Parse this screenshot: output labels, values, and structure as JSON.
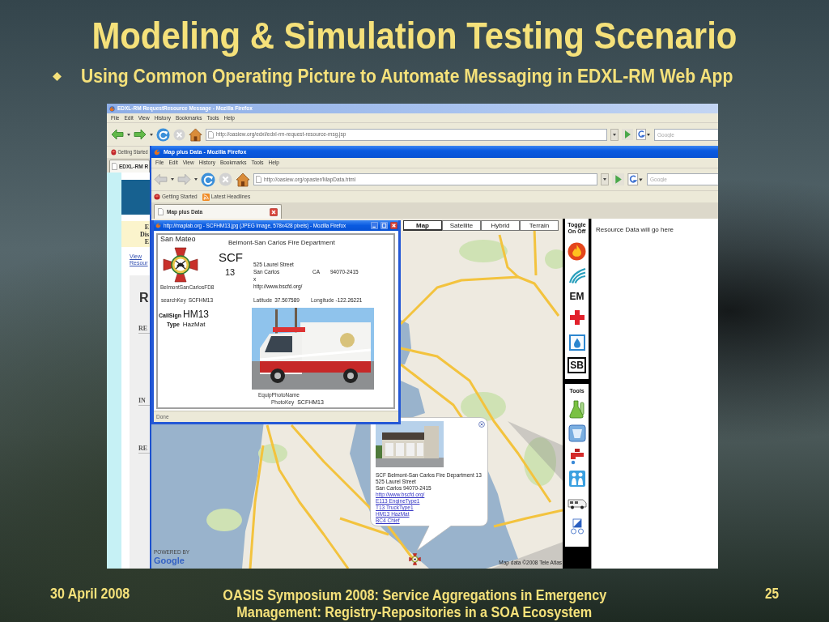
{
  "slide": {
    "title": "Modeling & Simulation Testing Scenario",
    "bullets": [
      "Using Common Operating Picture to Automate Messaging in EDXL-RM Web App"
    ]
  },
  "back_window": {
    "title": "EDXL-RM RequestResource Message - Mozilla Firefox",
    "menu": [
      "File",
      "Edit",
      "View",
      "History",
      "Bookmarks",
      "Tools",
      "Help"
    ],
    "navigation": {
      "back_disabled": false,
      "forward_disabled": false,
      "stop_disabled": true
    },
    "address": "http://oasiew.org/edxl/edxl-rm-request-resource-msg.jsp",
    "search": {
      "placeholder": "Google"
    },
    "bookmarks": [
      {
        "label": "Getting Started",
        "kind": "page"
      }
    ],
    "tabs": [
      {
        "label": "EDXL-RM R",
        "selected": true
      }
    ],
    "page": {
      "banner_lines": [
        "E",
        "Dis",
        "E"
      ],
      "links": [
        "View",
        "Resour"
      ],
      "heading": "R",
      "labels": [
        "RE",
        "IN",
        "RE"
      ]
    }
  },
  "map_window": {
    "title": "Map plus Data - Mozilla Firefox",
    "menu": [
      "File",
      "Edit",
      "View",
      "History",
      "Bookmarks",
      "Tools",
      "Help"
    ],
    "navigation": {
      "back_disabled": true,
      "forward_disabled": true,
      "stop_disabled": true
    },
    "address": "http://oasiew.org/opaster/MapData.html",
    "search": {
      "placeholder": "Google"
    },
    "bookmarks": [
      {
        "label": "Getting Started",
        "kind": "page"
      },
      {
        "label": "Latest Headlines",
        "kind": "feed"
      }
    ],
    "tabs": [
      {
        "label": "Map plus Data",
        "selected": true
      }
    ],
    "map": {
      "types": [
        {
          "label": "Map",
          "selected": true
        },
        {
          "label": "Satellite",
          "selected": false
        },
        {
          "label": "Hybrid",
          "selected": false
        },
        {
          "label": "Terrain",
          "selected": false
        }
      ],
      "info_bubble": {
        "lines": [
          "SCF Belmont-San Carlos Fire Department 13",
          "525 Laurel Street",
          "San Carlos 94070-2415"
        ],
        "links": [
          "http://www.bscfd.org/",
          "E113 EngineType1",
          "T13 TruckType1",
          "HM13 HazMat",
          "BC4 Chief"
        ]
      },
      "logo_caption": "POWERED BY",
      "logo": "Google",
      "attribution": "Map data ©2008 Tele Atlas"
    },
    "layer_toolbar": {
      "label": "Toggle On Off",
      "layers": [
        {
          "kind": "icon"
        },
        {
          "kind": "icon"
        },
        {
          "kind": "text",
          "label": "EM"
        },
        {
          "kind": "icon"
        },
        {
          "kind": "icon"
        },
        {
          "kind": "boxed",
          "label": "SB"
        }
      ],
      "tools_label": "Tools"
    },
    "side_panel": {
      "message": "Resource Data will go here"
    }
  },
  "image_window": {
    "title": "http://maplab.org - SCFHM13.jpg (JPEG Image, 578x428 pixels) - Mozilla Firefox",
    "status": "Done",
    "card": {
      "county": "San Mateo",
      "department": "Belmont-San Carlos Fire Department",
      "logo_caption": "BelmontSanCarlosFD8",
      "station_code": "SCF",
      "station_number": "13",
      "address": {
        "street": "525 Laurel Street",
        "city": "San Carlos",
        "state": "CA",
        "zip": "94070-2415",
        "line_4": "x",
        "url": "http://www.bscfd.org/"
      },
      "search_key": {
        "label": "searchKey",
        "value": "SCFHM13"
      },
      "latitude": {
        "label": "Latitude",
        "value": "37.507589"
      },
      "longitude": {
        "label": "Longitude",
        "value": "-122.26221"
      },
      "call_sign": {
        "label": "CallSign",
        "value": "HM13"
      },
      "type": {
        "label": "Type",
        "value": "HazMat"
      },
      "photo_name_label": "EquipPhotoName",
      "photo_key": {
        "label": "PhotoKey",
        "value": "SCFHM13"
      }
    }
  },
  "footer": {
    "date": "30 April 2008",
    "lines": [
      "OASIS Symposium 2008: Service Aggregations in Emergency",
      "Management: Registry-Repositories in a SOA Ecosystem"
    ],
    "page": "25"
  }
}
